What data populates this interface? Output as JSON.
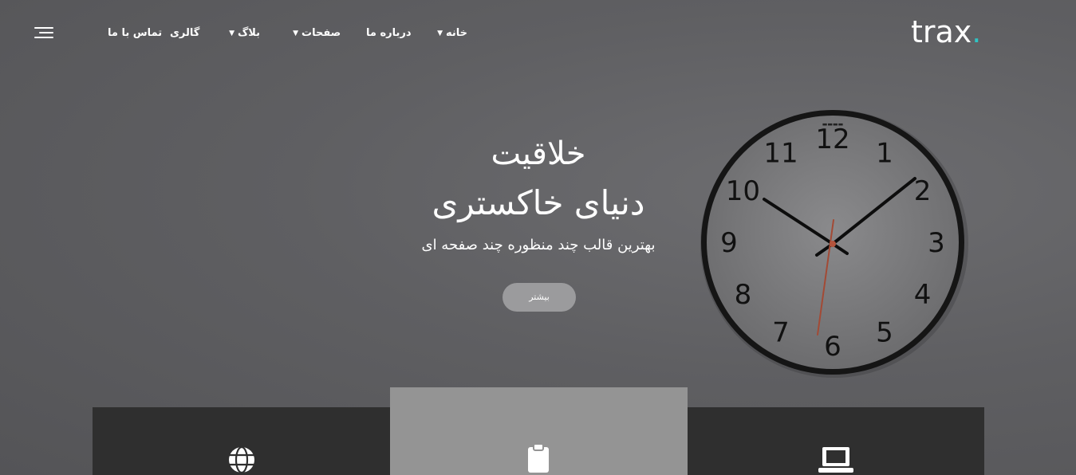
{
  "header": {
    "logo_text": "trax",
    "logo_dot": ".",
    "accent_color": "#2ec4c4",
    "nav": [
      {
        "label": "خانه",
        "has_dropdown": true
      },
      {
        "label": "درباره ما",
        "has_dropdown": false
      },
      {
        "label": "صفحات",
        "has_dropdown": true
      },
      {
        "label": "بلاگ",
        "has_dropdown": true
      },
      {
        "label": "گالری",
        "has_dropdown": false
      },
      {
        "label": "تماس با ما",
        "has_dropdown": false
      }
    ],
    "menu_icon": "hamburger-menu-icon"
  },
  "hero": {
    "title_line1": "خلاقیت",
    "title_line2": "دنیای خاکستری",
    "subtitle": "بهترین قالب چند منظوره چند صفحه ای",
    "button_label": "بیشتر",
    "clock": {
      "numbers": [
        "12",
        "1",
        "2",
        "3",
        "4",
        "5",
        "6",
        "7",
        "8",
        "9",
        "10",
        "11"
      ]
    }
  },
  "features": [
    {
      "icon": "globe-icon"
    },
    {
      "icon": "clipboard-icon"
    },
    {
      "icon": "laptop-icon"
    }
  ]
}
